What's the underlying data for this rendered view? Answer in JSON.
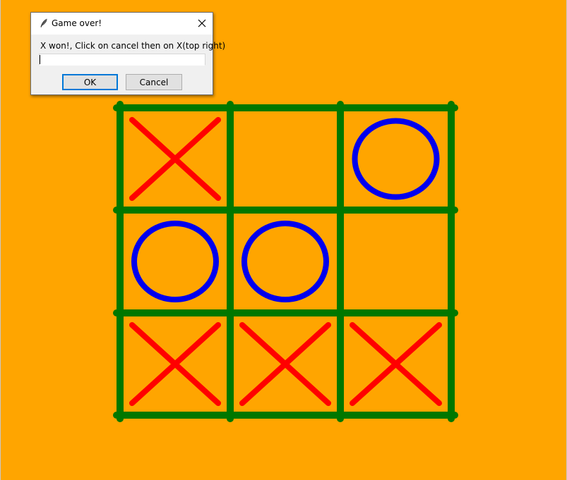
{
  "dialog": {
    "title": "Game over!",
    "message": "X won!, Click on cancel then on  X(top right)",
    "input_value": "",
    "ok_label": "OK",
    "cancel_label": "Cancel",
    "icons": {
      "title": "feather-icon",
      "close": "close-icon"
    }
  },
  "game": {
    "board": [
      [
        "X",
        "",
        "O"
      ],
      [
        "O",
        "O",
        ""
      ],
      [
        "X",
        "X",
        "X"
      ]
    ],
    "winner": "X",
    "colors": {
      "background": "#ffa500",
      "grid": "#007700",
      "x_mark": "#ff0000",
      "o_mark": "#0000ee"
    }
  }
}
